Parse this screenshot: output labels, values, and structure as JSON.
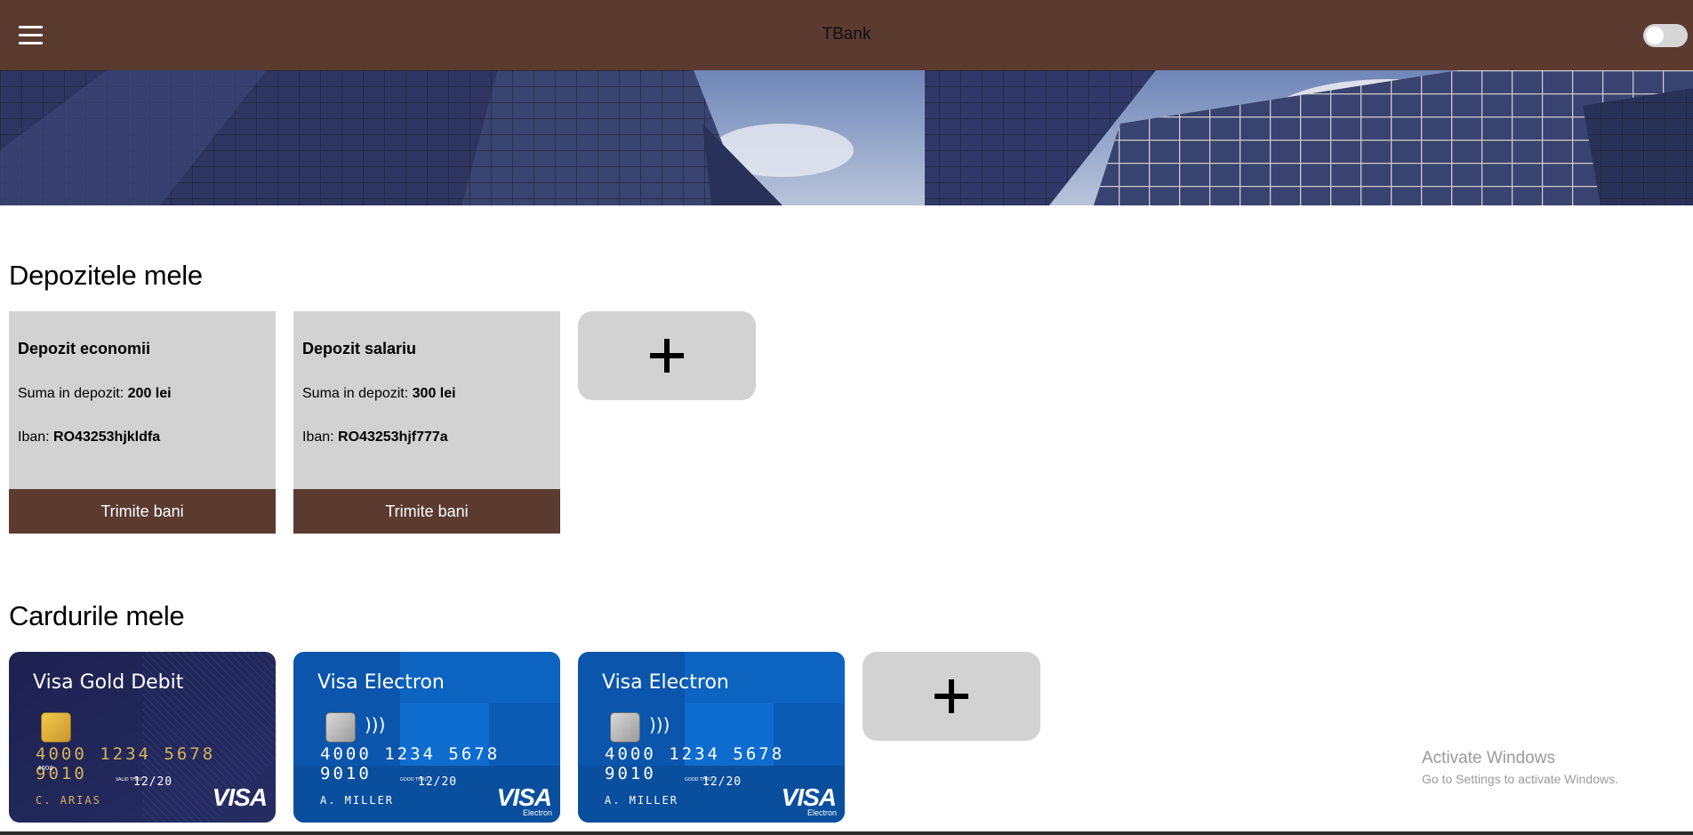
{
  "header": {
    "brand": "TBank",
    "menu_icon": "hamburger-menu-icon",
    "theme_toggle_on": false
  },
  "deposits": {
    "title": "Depozitele mele",
    "items": [
      {
        "name": "Depozit economii",
        "amount_label": "Suma in depozit:",
        "amount": "200 lei",
        "iban_label": "Iban:",
        "iban": "RO43253hjkldfa",
        "action": "Trimite bani"
      },
      {
        "name": "Depozit salariu",
        "amount_label": "Suma in depozit:",
        "amount": "300 lei",
        "iban_label": "Iban:",
        "iban": "RO43253hjf777a",
        "action": "Trimite bani"
      }
    ],
    "add_icon": "plus-icon"
  },
  "cards": {
    "title": "Cardurile mele",
    "items": [
      {
        "title": "Visa Gold Debit",
        "number": "4000 1234 5678 9010",
        "small_number": "4000",
        "valid_label": "VALID THRU",
        "expiry": "12/20",
        "holder": "C. ARIAS",
        "brand": "VISA",
        "brand_sub": ""
      },
      {
        "title": "Visa Electron",
        "number": "4000 1234 5678 9010",
        "small_number": "",
        "valid_label": "GOOD THRU",
        "expiry": "12/20",
        "holder": "A. MILLER",
        "brand": "VISA",
        "brand_sub": "Electron"
      },
      {
        "title": "Visa Electron",
        "number": "4000 1234 5678 9010",
        "small_number": "",
        "valid_label": "GOOD THRU",
        "expiry": "12/20",
        "holder": "A. MILLER",
        "brand": "VISA",
        "brand_sub": "Electron"
      }
    ],
    "add_icon": "plus-icon"
  },
  "watermark": {
    "line1": "Activate Windows",
    "line2": "Go to Settings to activate Windows."
  },
  "colors": {
    "header_bg": "#5b3a30",
    "tile_bg": "#d2d2d2",
    "button_bg": "#5b3a30",
    "gold_card": "#1f2452",
    "electron_card": "#0a55a8"
  }
}
